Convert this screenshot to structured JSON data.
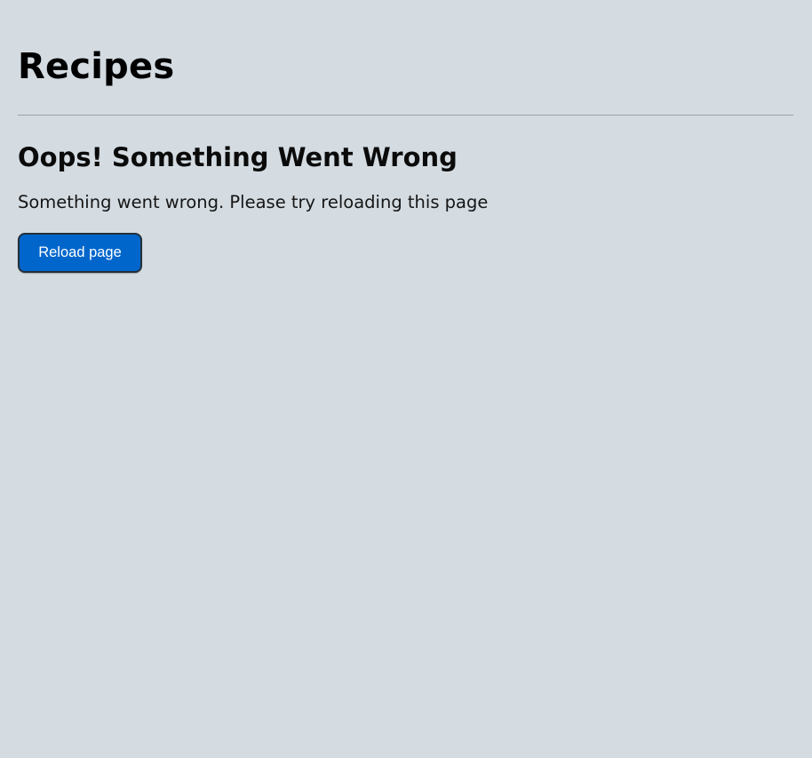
{
  "page": {
    "title": "Recipes"
  },
  "error": {
    "heading": "Oops! Something Went Wrong",
    "message": "Something went wrong. Please try reloading this page",
    "reload_label": "Reload page"
  },
  "colors": {
    "background": "#d4dce2",
    "button": "#0066cc",
    "button_text": "#ffffff",
    "divider": "#9aa3ab"
  }
}
